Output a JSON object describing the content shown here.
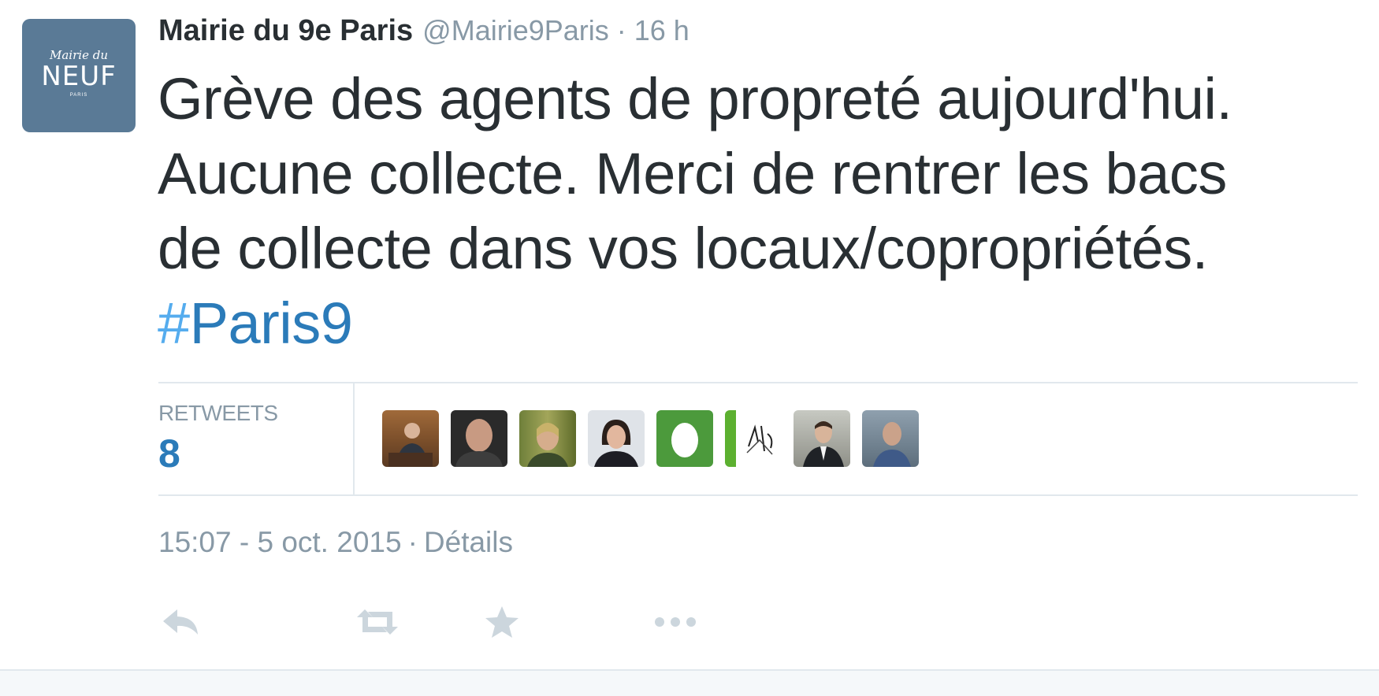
{
  "account": {
    "avatar": {
      "line1": "Mairie du",
      "line2": "NEUF",
      "line3": "PARIS",
      "bg_color": "#5a7a96"
    },
    "fullname": "Mairie du 9e Paris",
    "username": "@Mairie9Paris",
    "separator": "·",
    "time_ago": "16 h"
  },
  "tweet": {
    "lines": [
      "Grève des agents de propreté aujourd'hui.",
      "Aucune collecte. Merci de rentrer les bacs",
      "de collecte dans vos locaux/copropriétés."
    ],
    "hashtag": {
      "hash": "#",
      "tag": "Paris9"
    }
  },
  "stats": {
    "retweets_label": "RETWEETS",
    "retweets_count": "8",
    "retweeter_avatars": [
      {
        "name": "retweeter-avatar-1"
      },
      {
        "name": "retweeter-avatar-2"
      },
      {
        "name": "retweeter-avatar-3"
      },
      {
        "name": "retweeter-avatar-4"
      },
      {
        "name": "retweeter-avatar-5-default-egg"
      },
      {
        "name": "retweeter-avatar-6-action-barbes",
        "text": "ActionBarbès"
      },
      {
        "name": "retweeter-avatar-7"
      },
      {
        "name": "retweeter-avatar-8"
      }
    ]
  },
  "meta": {
    "timestamp": "15:07 - 5 oct. 2015",
    "separator": "·",
    "details_label": "Détails"
  },
  "actions": {
    "reply_icon": "reply-icon",
    "retweet_icon": "retweet-icon",
    "favorite_icon": "star-icon",
    "more_icon": "more-icon"
  },
  "colors": {
    "text": "#292f33",
    "muted": "#8899a6",
    "link": "#2b7bb9",
    "border": "#e1e8ed",
    "action_icon": "#ccd6dd"
  }
}
